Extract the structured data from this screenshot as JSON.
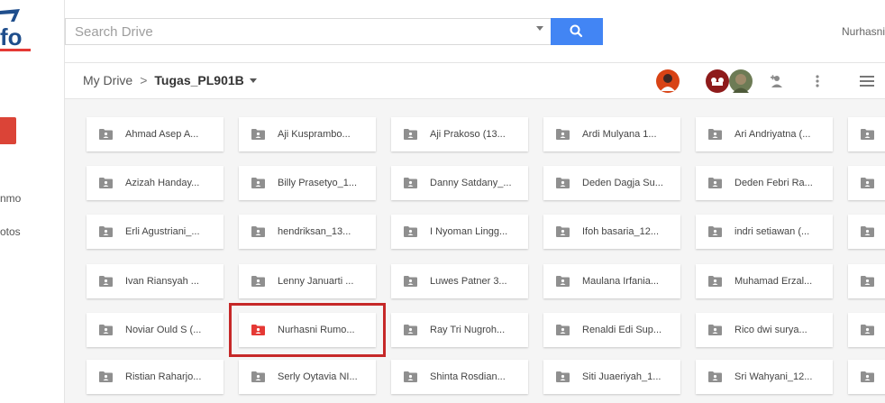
{
  "app": {
    "user_name": "Nurhasni"
  },
  "search": {
    "placeholder": "Search Drive"
  },
  "sidebar": {
    "items": [
      {
        "label": "nmo"
      },
      {
        "label": "otos"
      }
    ]
  },
  "breadcrumb": {
    "root": "My Drive",
    "separator": ">",
    "current": "Tugas_PL901B"
  },
  "colors": {
    "accent_blue": "#4285f4",
    "new_button_red": "#db4437",
    "highlight_red": "#c62828",
    "folder_grey": "#8f8f8f",
    "folder_red": "#e53935"
  },
  "folders": [
    [
      "Ahmad Asep A...",
      "Aji Kusprambo...",
      "Aji Prakoso (13...",
      "Ardi Mulyana 1...",
      "Ari Andriyatna (...",
      ""
    ],
    [
      "Azizah Handay...",
      "Billy Prasetyo_1...",
      "Danny Satdany_...",
      "Deden Dagja Su...",
      "Deden Febri Ra...",
      ""
    ],
    [
      "Erli Agustriani_...",
      "hendriksan_13...",
      "I Nyoman Lingg...",
      "Ifoh basaria_12...",
      "indri setiawan (...",
      ""
    ],
    [
      "Ivan Riansyah ...",
      "Lenny Januarti ...",
      "Luwes Patner 3...",
      "Maulana Irfania...",
      "Muhamad Erzal...",
      ""
    ],
    [
      "Noviar Ould S (...",
      "Nurhasni Rumo...",
      "Ray Tri Nugroh...",
      "Renaldi Edi Sup...",
      "Rico dwi surya...",
      ""
    ],
    [
      "Ristian Raharjo...",
      "Serly Oytavia NI...",
      "Shinta Rosdian...",
      "Siti Juaeriyah_1...",
      "Sri Wahyani_12...",
      ""
    ]
  ],
  "selected_folder": "Nurhasni Rumo..."
}
